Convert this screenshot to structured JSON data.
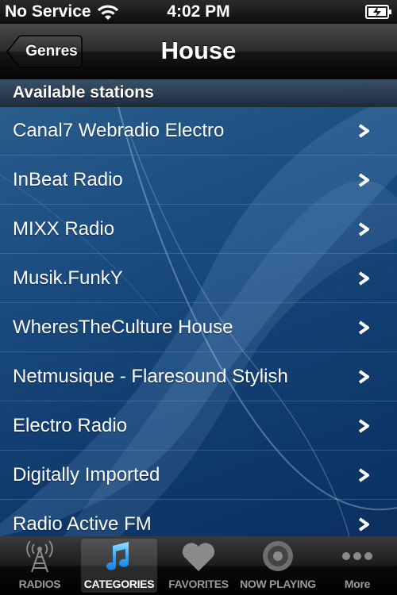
{
  "status_bar": {
    "carrier": "No Service",
    "time": "4:02 PM"
  },
  "nav_bar": {
    "back_label": "Genres",
    "title": "House"
  },
  "section": {
    "header": "Available stations"
  },
  "stations": [
    "Canal7 Webradio Electro",
    "InBeat Radio",
    "MIXX Radio",
    "Musik.FunkY",
    "WheresTheCulture House",
    "Netmusique - Flaresound Stylish",
    "Electro Radio",
    "Digitally Imported",
    "Radio Active FM"
  ],
  "tabs": [
    {
      "label": "RADIOS",
      "icon": "radio-tower-icon"
    },
    {
      "label": "CATEGORIES",
      "icon": "music-note-icon",
      "selected": true
    },
    {
      "label": "FAVORITES",
      "icon": "heart-icon"
    },
    {
      "label": "NOW PLAYING",
      "icon": "speaker-icon"
    },
    {
      "label": "More",
      "icon": "more-dots-icon"
    }
  ],
  "colors": {
    "selected_tab_icon": "#33aaff",
    "inactive_tab": "#999999"
  }
}
